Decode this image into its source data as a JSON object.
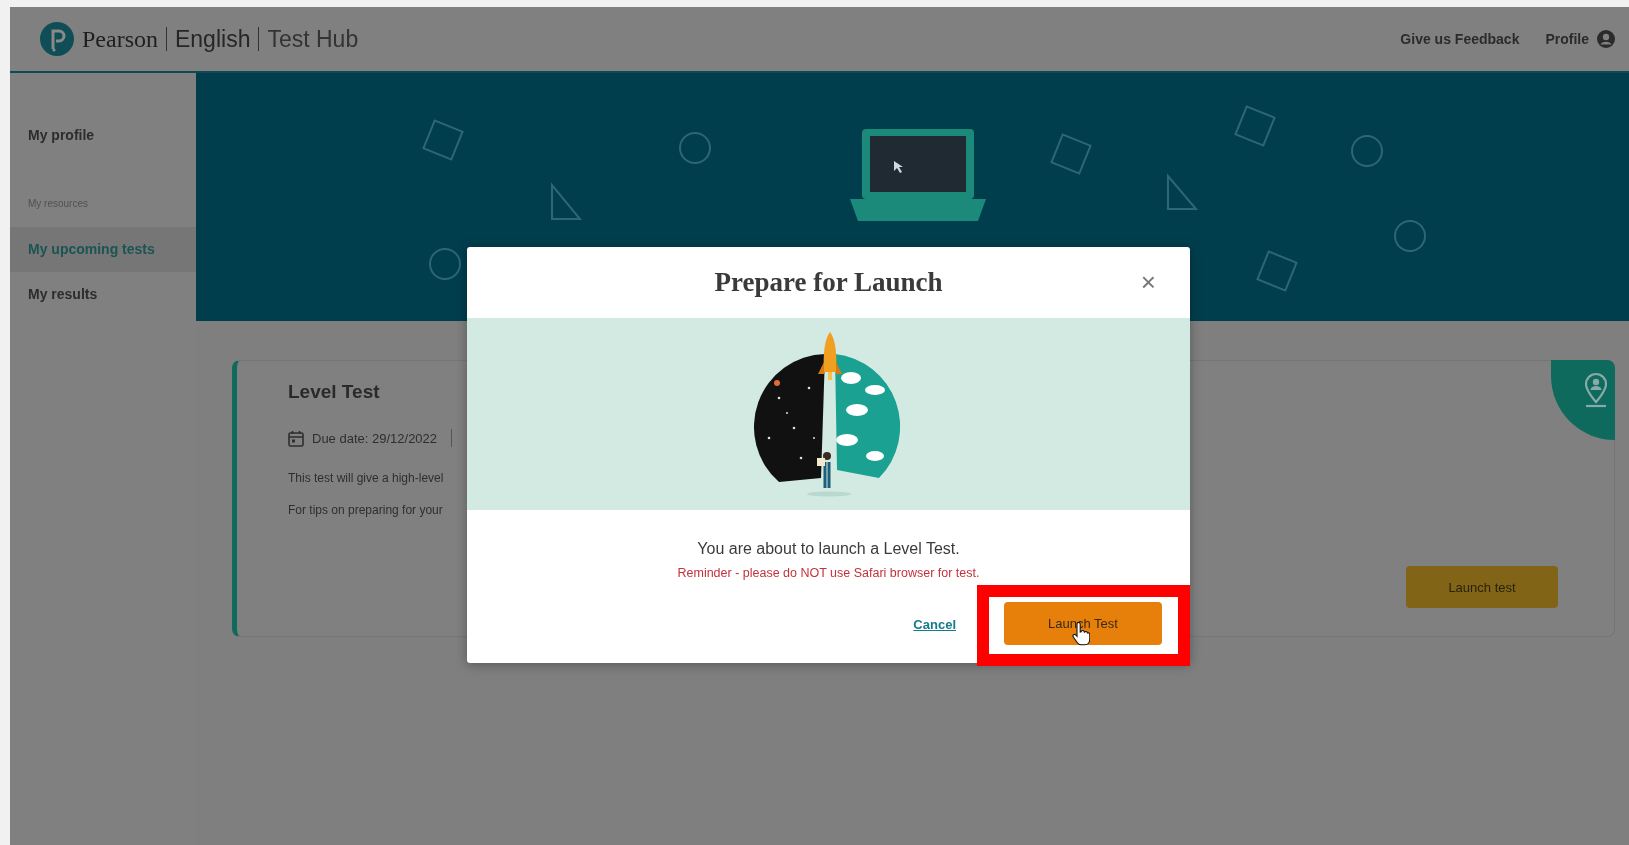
{
  "header": {
    "brand": "Pearson",
    "product": "English",
    "section": "Test Hub",
    "links": [
      {
        "label": "Give us Feedback",
        "kind": "text"
      },
      {
        "label": "Profile",
        "kind": "profile"
      }
    ]
  },
  "sidebar": {
    "items": [
      {
        "label": "My profile",
        "kind": "link",
        "selected": false
      },
      {
        "label": "My resources",
        "kind": "heading"
      },
      {
        "label": "My upcoming tests",
        "kind": "link",
        "selected": true
      },
      {
        "label": "My results",
        "kind": "link",
        "selected": false
      }
    ]
  },
  "test_card": {
    "title": "Level Test",
    "due_date": "Due date: 29/12/2022",
    "description": [
      "This test will give a high-level",
      "For tips on preparing for your"
    ],
    "button": "Launch test"
  },
  "dialog": {
    "title": "Prepare for Launch",
    "close": "×",
    "message": "You are about to launch a Level Test.",
    "reminder": "Reminder - please do NOT use Safari browser for test.",
    "buttons": [
      {
        "label": "Cancel",
        "kind": "link"
      },
      {
        "label": "Launch Test",
        "kind": "primary",
        "highlighted": true
      }
    ]
  }
}
